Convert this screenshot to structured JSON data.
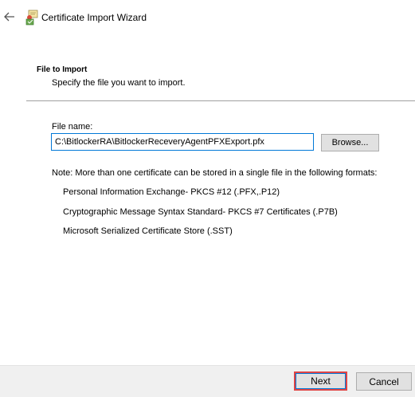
{
  "window": {
    "title": "Certificate Import Wizard",
    "back_icon": "arrow-left-icon",
    "app_icon": "certificate-wizard-icon"
  },
  "header": {
    "title": "File to Import",
    "subtitle": "Specify the file you want to import."
  },
  "file": {
    "label": "File name:",
    "value": "C:\\BitlockerRA\\BitlockerReceveryAgentPFXExport.pfx",
    "browse_label": "Browse..."
  },
  "note": "Note:  More than one certificate can be stored in a single file in the following formats:",
  "formats": [
    "Personal Information Exchange- PKCS #12 (.PFX,.P12)",
    "Cryptographic Message Syntax Standard- PKCS #7 Certificates (.P7B)",
    "Microsoft Serialized Certificate Store (.SST)"
  ],
  "footer": {
    "next_label": "Next",
    "cancel_label": "Cancel"
  },
  "colors": {
    "highlight": "#e04545",
    "focus": "#0078d7",
    "footer_bg": "#f0f0f0"
  }
}
